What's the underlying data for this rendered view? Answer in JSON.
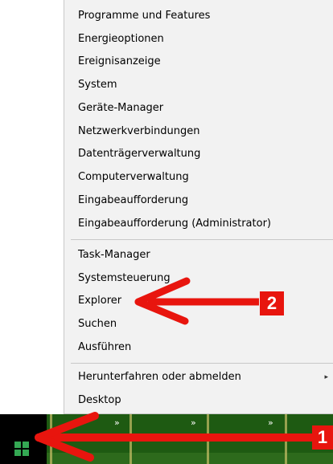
{
  "menu": {
    "group1": [
      "Programme und Features",
      "Energieoptionen",
      "Ereignisanzeige",
      "System",
      "Geräte-Manager",
      "Netzwerkverbindungen",
      "Datenträgerverwaltung",
      "Computerverwaltung",
      "Eingabeaufforderung",
      "Eingabeaufforderung (Administrator)"
    ],
    "group2": [
      "Task-Manager",
      "Systemsteuerung",
      "Explorer",
      "Suchen",
      "Ausführen"
    ],
    "group3": [
      "Herunterfahren oder abmelden",
      "Desktop"
    ],
    "submenu_arrow": "▸"
  },
  "annotations": {
    "badge1": "1",
    "badge2": "2",
    "arrow_color": "#e8150e"
  },
  "taskbar": {
    "chevron": "»",
    "start_icon": "windows-logo-icon",
    "start_color": "#34a853"
  }
}
